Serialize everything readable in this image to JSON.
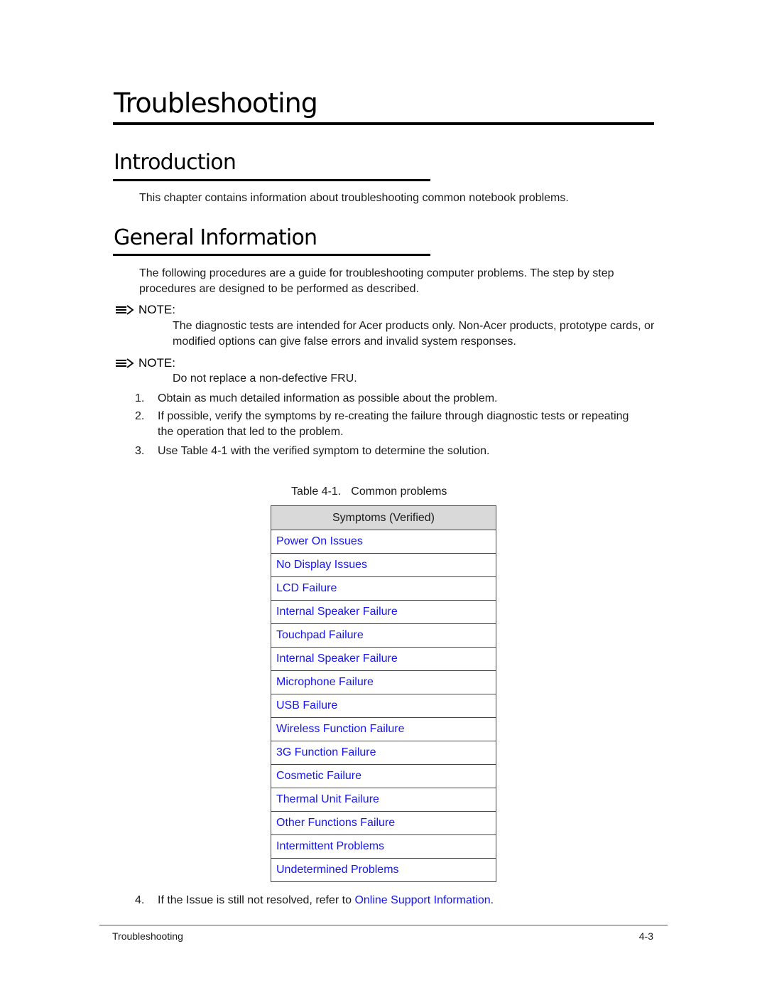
{
  "chapter_title": "Troubleshooting",
  "sections": {
    "introduction": {
      "heading": "Introduction",
      "body": "This chapter contains information about troubleshooting common notebook problems."
    },
    "general": {
      "heading": "General Information",
      "body": "The following procedures are a guide for troubleshooting computer problems. The step by step procedures are designed to be performed as described.",
      "notes": [
        {
          "label": "NOTE:",
          "icon": "note-arrow-icon",
          "text": "The diagnostic tests are intended for Acer products only. Non-Acer products, prototype cards, or modified options can give false errors and invalid system responses."
        },
        {
          "label": "NOTE:",
          "icon": "note-arrow-icon",
          "text": "Do not replace a non-defective FRU."
        }
      ],
      "steps": [
        {
          "num": "1.",
          "text": "Obtain as much detailed information as possible about the problem."
        },
        {
          "num": "2.",
          "text": "If possible, verify the symptoms by re-creating the failure through diagnostic tests or repeating the operation that led to the problem."
        },
        {
          "num": "3.",
          "text": "Use Table 4-1 with the verified symptom to determine the solution."
        }
      ],
      "final_step": {
        "num": "4.",
        "text_before": "If the Issue is still not resolved, refer to ",
        "link": "Online Support Information",
        "text_after": "."
      }
    }
  },
  "table": {
    "caption_num": "Table 4-1.",
    "caption_title": "Common problems",
    "header": "Symptoms (Verified)",
    "rows": [
      "Power On Issues",
      "No Display Issues",
      "LCD Failure",
      "Internal Speaker Failure",
      "Touchpad Failure",
      "Internal Speaker Failure",
      "Microphone Failure",
      "USB Failure",
      "Wireless Function Failure",
      "3G Function Failure",
      "Cosmetic Failure",
      "Thermal Unit Failure",
      "Other Functions Failure",
      "Intermittent Problems",
      "Undetermined Problems"
    ]
  },
  "footer": {
    "left": "Troubleshooting",
    "page": "4-3"
  },
  "colors": {
    "link": "#1515f0",
    "table_header_bg": "#d9d9d9"
  }
}
